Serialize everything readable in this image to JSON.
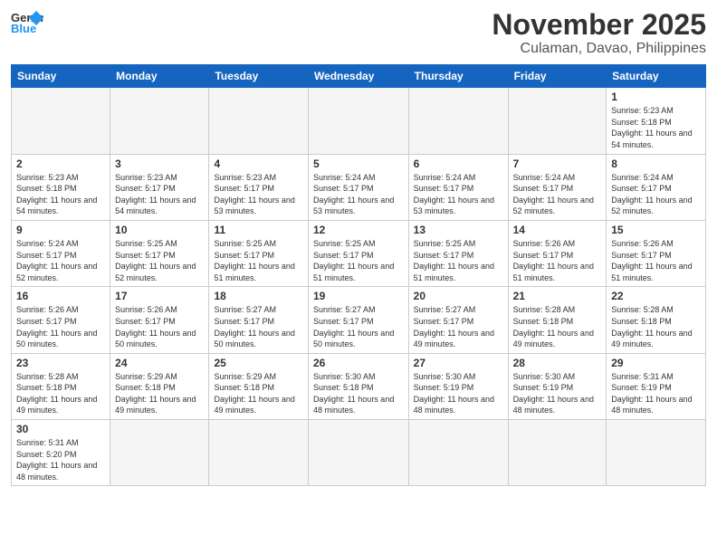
{
  "logo": {
    "general": "General",
    "blue": "Blue"
  },
  "header": {
    "month": "November 2025",
    "location": "Culaman, Davao, Philippines"
  },
  "weekdays": [
    "Sunday",
    "Monday",
    "Tuesday",
    "Wednesday",
    "Thursday",
    "Friday",
    "Saturday"
  ],
  "days": [
    {
      "num": "1",
      "sunrise": "5:23 AM",
      "sunset": "5:18 PM",
      "daylight": "11 hours and 54 minutes."
    },
    {
      "num": "2",
      "sunrise": "5:23 AM",
      "sunset": "5:18 PM",
      "daylight": "11 hours and 54 minutes."
    },
    {
      "num": "3",
      "sunrise": "5:23 AM",
      "sunset": "5:17 PM",
      "daylight": "11 hours and 54 minutes."
    },
    {
      "num": "4",
      "sunrise": "5:23 AM",
      "sunset": "5:17 PM",
      "daylight": "11 hours and 53 minutes."
    },
    {
      "num": "5",
      "sunrise": "5:24 AM",
      "sunset": "5:17 PM",
      "daylight": "11 hours and 53 minutes."
    },
    {
      "num": "6",
      "sunrise": "5:24 AM",
      "sunset": "5:17 PM",
      "daylight": "11 hours and 53 minutes."
    },
    {
      "num": "7",
      "sunrise": "5:24 AM",
      "sunset": "5:17 PM",
      "daylight": "11 hours and 52 minutes."
    },
    {
      "num": "8",
      "sunrise": "5:24 AM",
      "sunset": "5:17 PM",
      "daylight": "11 hours and 52 minutes."
    },
    {
      "num": "9",
      "sunrise": "5:24 AM",
      "sunset": "5:17 PM",
      "daylight": "11 hours and 52 minutes."
    },
    {
      "num": "10",
      "sunrise": "5:25 AM",
      "sunset": "5:17 PM",
      "daylight": "11 hours and 52 minutes."
    },
    {
      "num": "11",
      "sunrise": "5:25 AM",
      "sunset": "5:17 PM",
      "daylight": "11 hours and 51 minutes."
    },
    {
      "num": "12",
      "sunrise": "5:25 AM",
      "sunset": "5:17 PM",
      "daylight": "11 hours and 51 minutes."
    },
    {
      "num": "13",
      "sunrise": "5:25 AM",
      "sunset": "5:17 PM",
      "daylight": "11 hours and 51 minutes."
    },
    {
      "num": "14",
      "sunrise": "5:26 AM",
      "sunset": "5:17 PM",
      "daylight": "11 hours and 51 minutes."
    },
    {
      "num": "15",
      "sunrise": "5:26 AM",
      "sunset": "5:17 PM",
      "daylight": "11 hours and 51 minutes."
    },
    {
      "num": "16",
      "sunrise": "5:26 AM",
      "sunset": "5:17 PM",
      "daylight": "11 hours and 50 minutes."
    },
    {
      "num": "17",
      "sunrise": "5:26 AM",
      "sunset": "5:17 PM",
      "daylight": "11 hours and 50 minutes."
    },
    {
      "num": "18",
      "sunrise": "5:27 AM",
      "sunset": "5:17 PM",
      "daylight": "11 hours and 50 minutes."
    },
    {
      "num": "19",
      "sunrise": "5:27 AM",
      "sunset": "5:17 PM",
      "daylight": "11 hours and 50 minutes."
    },
    {
      "num": "20",
      "sunrise": "5:27 AM",
      "sunset": "5:17 PM",
      "daylight": "11 hours and 49 minutes."
    },
    {
      "num": "21",
      "sunrise": "5:28 AM",
      "sunset": "5:18 PM",
      "daylight": "11 hours and 49 minutes."
    },
    {
      "num": "22",
      "sunrise": "5:28 AM",
      "sunset": "5:18 PM",
      "daylight": "11 hours and 49 minutes."
    },
    {
      "num": "23",
      "sunrise": "5:28 AM",
      "sunset": "5:18 PM",
      "daylight": "11 hours and 49 minutes."
    },
    {
      "num": "24",
      "sunrise": "5:29 AM",
      "sunset": "5:18 PM",
      "daylight": "11 hours and 49 minutes."
    },
    {
      "num": "25",
      "sunrise": "5:29 AM",
      "sunset": "5:18 PM",
      "daylight": "11 hours and 49 minutes."
    },
    {
      "num": "26",
      "sunrise": "5:30 AM",
      "sunset": "5:18 PM",
      "daylight": "11 hours and 48 minutes."
    },
    {
      "num": "27",
      "sunrise": "5:30 AM",
      "sunset": "5:19 PM",
      "daylight": "11 hours and 48 minutes."
    },
    {
      "num": "28",
      "sunrise": "5:30 AM",
      "sunset": "5:19 PM",
      "daylight": "11 hours and 48 minutes."
    },
    {
      "num": "29",
      "sunrise": "5:31 AM",
      "sunset": "5:19 PM",
      "daylight": "11 hours and 48 minutes."
    },
    {
      "num": "30",
      "sunrise": "5:31 AM",
      "sunset": "5:20 PM",
      "daylight": "11 hours and 48 minutes."
    }
  ]
}
